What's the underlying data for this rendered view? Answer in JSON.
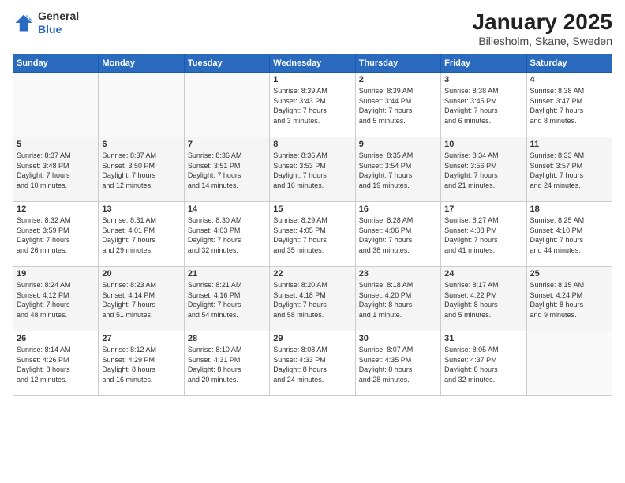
{
  "logo": {
    "general": "General",
    "blue": "Blue"
  },
  "title": "January 2025",
  "subtitle": "Billesholm, Skane, Sweden",
  "weekdays": [
    "Sunday",
    "Monday",
    "Tuesday",
    "Wednesday",
    "Thursday",
    "Friday",
    "Saturday"
  ],
  "weeks": [
    [
      {
        "day": "",
        "info": ""
      },
      {
        "day": "",
        "info": ""
      },
      {
        "day": "",
        "info": ""
      },
      {
        "day": "1",
        "info": "Sunrise: 8:39 AM\nSunset: 3:43 PM\nDaylight: 7 hours\nand 3 minutes."
      },
      {
        "day": "2",
        "info": "Sunrise: 8:39 AM\nSunset: 3:44 PM\nDaylight: 7 hours\nand 5 minutes."
      },
      {
        "day": "3",
        "info": "Sunrise: 8:38 AM\nSunset: 3:45 PM\nDaylight: 7 hours\nand 6 minutes."
      },
      {
        "day": "4",
        "info": "Sunrise: 8:38 AM\nSunset: 3:47 PM\nDaylight: 7 hours\nand 8 minutes."
      }
    ],
    [
      {
        "day": "5",
        "info": "Sunrise: 8:37 AM\nSunset: 3:48 PM\nDaylight: 7 hours\nand 10 minutes."
      },
      {
        "day": "6",
        "info": "Sunrise: 8:37 AM\nSunset: 3:50 PM\nDaylight: 7 hours\nand 12 minutes."
      },
      {
        "day": "7",
        "info": "Sunrise: 8:36 AM\nSunset: 3:51 PM\nDaylight: 7 hours\nand 14 minutes."
      },
      {
        "day": "8",
        "info": "Sunrise: 8:36 AM\nSunset: 3:53 PM\nDaylight: 7 hours\nand 16 minutes."
      },
      {
        "day": "9",
        "info": "Sunrise: 8:35 AM\nSunset: 3:54 PM\nDaylight: 7 hours\nand 19 minutes."
      },
      {
        "day": "10",
        "info": "Sunrise: 8:34 AM\nSunset: 3:56 PM\nDaylight: 7 hours\nand 21 minutes."
      },
      {
        "day": "11",
        "info": "Sunrise: 8:33 AM\nSunset: 3:57 PM\nDaylight: 7 hours\nand 24 minutes."
      }
    ],
    [
      {
        "day": "12",
        "info": "Sunrise: 8:32 AM\nSunset: 3:59 PM\nDaylight: 7 hours\nand 26 minutes."
      },
      {
        "day": "13",
        "info": "Sunrise: 8:31 AM\nSunset: 4:01 PM\nDaylight: 7 hours\nand 29 minutes."
      },
      {
        "day": "14",
        "info": "Sunrise: 8:30 AM\nSunset: 4:03 PM\nDaylight: 7 hours\nand 32 minutes."
      },
      {
        "day": "15",
        "info": "Sunrise: 8:29 AM\nSunset: 4:05 PM\nDaylight: 7 hours\nand 35 minutes."
      },
      {
        "day": "16",
        "info": "Sunrise: 8:28 AM\nSunset: 4:06 PM\nDaylight: 7 hours\nand 38 minutes."
      },
      {
        "day": "17",
        "info": "Sunrise: 8:27 AM\nSunset: 4:08 PM\nDaylight: 7 hours\nand 41 minutes."
      },
      {
        "day": "18",
        "info": "Sunrise: 8:25 AM\nSunset: 4:10 PM\nDaylight: 7 hours\nand 44 minutes."
      }
    ],
    [
      {
        "day": "19",
        "info": "Sunrise: 8:24 AM\nSunset: 4:12 PM\nDaylight: 7 hours\nand 48 minutes."
      },
      {
        "day": "20",
        "info": "Sunrise: 8:23 AM\nSunset: 4:14 PM\nDaylight: 7 hours\nand 51 minutes."
      },
      {
        "day": "21",
        "info": "Sunrise: 8:21 AM\nSunset: 4:16 PM\nDaylight: 7 hours\nand 54 minutes."
      },
      {
        "day": "22",
        "info": "Sunrise: 8:20 AM\nSunset: 4:18 PM\nDaylight: 7 hours\nand 58 minutes."
      },
      {
        "day": "23",
        "info": "Sunrise: 8:18 AM\nSunset: 4:20 PM\nDaylight: 8 hours\nand 1 minute."
      },
      {
        "day": "24",
        "info": "Sunrise: 8:17 AM\nSunset: 4:22 PM\nDaylight: 8 hours\nand 5 minutes."
      },
      {
        "day": "25",
        "info": "Sunrise: 8:15 AM\nSunset: 4:24 PM\nDaylight: 8 hours\nand 9 minutes."
      }
    ],
    [
      {
        "day": "26",
        "info": "Sunrise: 8:14 AM\nSunset: 4:26 PM\nDaylight: 8 hours\nand 12 minutes."
      },
      {
        "day": "27",
        "info": "Sunrise: 8:12 AM\nSunset: 4:29 PM\nDaylight: 8 hours\nand 16 minutes."
      },
      {
        "day": "28",
        "info": "Sunrise: 8:10 AM\nSunset: 4:31 PM\nDaylight: 8 hours\nand 20 minutes."
      },
      {
        "day": "29",
        "info": "Sunrise: 8:08 AM\nSunset: 4:33 PM\nDaylight: 8 hours\nand 24 minutes."
      },
      {
        "day": "30",
        "info": "Sunrise: 8:07 AM\nSunset: 4:35 PM\nDaylight: 8 hours\nand 28 minutes."
      },
      {
        "day": "31",
        "info": "Sunrise: 8:05 AM\nSunset: 4:37 PM\nDaylight: 8 hours\nand 32 minutes."
      },
      {
        "day": "",
        "info": ""
      }
    ]
  ]
}
